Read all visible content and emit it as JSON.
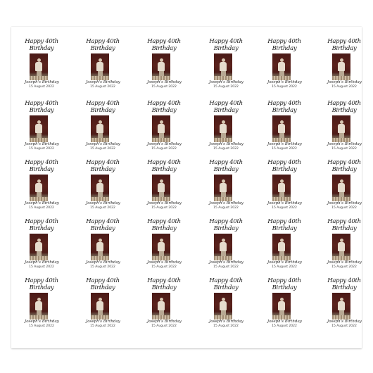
{
  "tile": {
    "line1": "Happy 40th",
    "line2": "Birthday",
    "name": "Joseph's Birthday",
    "date": "15 August 2022",
    "photo_icon": "portrait-photo"
  },
  "grid": {
    "rows": 5,
    "cols": 6
  },
  "colors": {
    "paper": "#ffffff",
    "photo_background": "#4a1a17",
    "text": "#1a1a1a"
  }
}
